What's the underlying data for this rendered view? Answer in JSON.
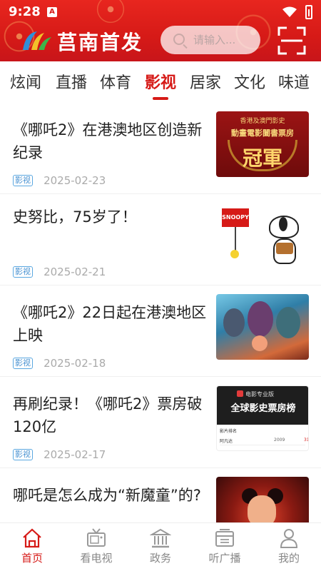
{
  "status_bar": {
    "time": "9:28",
    "notification_letter": "A"
  },
  "header": {
    "app_title": "莒南首发",
    "search_placeholder": "请输入..."
  },
  "tabs": [
    {
      "label": "炫闻"
    },
    {
      "label": "直播"
    },
    {
      "label": "体育"
    },
    {
      "label": "影视",
      "active": true
    },
    {
      "label": "居家"
    },
    {
      "label": "文化"
    },
    {
      "label": "味道"
    }
  ],
  "news": [
    {
      "title": "《哪吒2》在港澳地区创造新纪录",
      "tag": "影视",
      "date": "2025-02-23",
      "thumb_text": {
        "top": "香港及澳門影史",
        "mid": "動畫電影闔書票房",
        "big": "冠軍"
      }
    },
    {
      "title": "史努比，75岁了！",
      "tag": "影视",
      "date": "2025-02-21",
      "thumb_text": {
        "sign": "SNOOPY"
      }
    },
    {
      "title": "《哪吒2》22日起在港澳地区上映",
      "tag": "影视",
      "date": "2025-02-18"
    },
    {
      "title": "再刷纪录！《哪吒2》票房破120亿",
      "tag": "影视",
      "date": "2025-02-17",
      "thumb_text": {
        "brand": "电影专业版",
        "title": "全球影史票房榜",
        "head": "影片排名",
        "row": "阿凡达",
        "col1": "2009",
        "col2": "31"
      }
    },
    {
      "title": "哪吒是怎么成为“新魔童”的?",
      "tag": "影视",
      "date": ""
    }
  ],
  "bottom_nav": [
    {
      "label": "首页",
      "icon": "home-icon",
      "active": true
    },
    {
      "label": "看电视",
      "icon": "tv-icon"
    },
    {
      "label": "政务",
      "icon": "government-icon"
    },
    {
      "label": "听广播",
      "icon": "radio-icon"
    },
    {
      "label": "我的",
      "icon": "profile-icon"
    }
  ],
  "colors": {
    "brand_red": "#d61a17",
    "tag_blue": "#4a93d2",
    "muted": "#aaaaaa"
  }
}
